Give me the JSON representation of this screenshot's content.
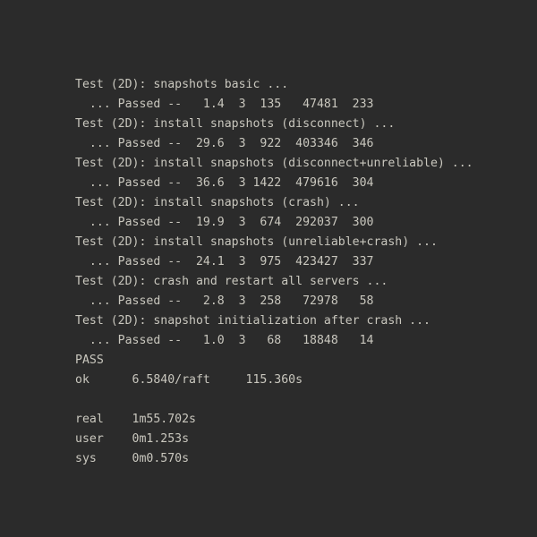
{
  "terminal": {
    "background_color": "#2b2b2b",
    "text_color": "#c9c7be",
    "font_size_px": 13.2,
    "line_height_px": 22,
    "lines": [
      "Test (2D): snapshots basic ...",
      "  ... Passed --   1.4  3  135   47481  233",
      "Test (2D): install snapshots (disconnect) ...",
      "  ... Passed --  29.6  3  922  403346  346",
      "Test (2D): install snapshots (disconnect+unreliable) ...",
      "  ... Passed --  36.6  3 1422  479616  304",
      "Test (2D): install snapshots (crash) ...",
      "  ... Passed --  19.9  3  674  292037  300",
      "Test (2D): install snapshots (unreliable+crash) ...",
      "  ... Passed --  24.1  3  975  423427  337",
      "Test (2D): crash and restart all servers ...",
      "  ... Passed --   2.8  3  258   72978   58",
      "Test (2D): snapshot initialization after crash ...",
      "  ... Passed --   1.0  3   68   18848   14",
      "PASS",
      "ok      6.5840/raft     115.360s",
      "",
      "real    1m55.702s",
      "user    0m1.253s",
      "sys     0m0.570s"
    ],
    "tests": [
      {
        "name": "Test (2D): snapshots basic ...",
        "status": "Passed",
        "time_s": "1.4",
        "peers": "3",
        "rpcs": "135",
        "bytes": "47481",
        "commits": "233"
      },
      {
        "name": "Test (2D): install snapshots (disconnect) ...",
        "status": "Passed",
        "time_s": "29.6",
        "peers": "3",
        "rpcs": "922",
        "bytes": "403346",
        "commits": "346"
      },
      {
        "name": "Test (2D): install snapshots (disconnect+unreliable) ...",
        "status": "Passed",
        "time_s": "36.6",
        "peers": "3",
        "rpcs": "1422",
        "bytes": "479616",
        "commits": "304"
      },
      {
        "name": "Test (2D): install snapshots (crash) ...",
        "status": "Passed",
        "time_s": "19.9",
        "peers": "3",
        "rpcs": "674",
        "bytes": "292037",
        "commits": "300"
      },
      {
        "name": "Test (2D): install snapshots (unreliable+crash) ...",
        "status": "Passed",
        "time_s": "24.1",
        "peers": "3",
        "rpcs": "975",
        "bytes": "423427",
        "commits": "337"
      },
      {
        "name": "Test (2D): crash and restart all servers ...",
        "status": "Passed",
        "time_s": "2.8",
        "peers": "3",
        "rpcs": "258",
        "bytes": "72978",
        "commits": "58"
      },
      {
        "name": "Test (2D): snapshot initialization after crash ...",
        "status": "Passed",
        "time_s": "1.0",
        "peers": "3",
        "rpcs": "68",
        "bytes": "18848",
        "commits": "14"
      }
    ],
    "summary": {
      "result": "PASS",
      "ok_label": "ok",
      "package": "6.5840/raft",
      "package_time": "115.360s"
    },
    "timing": {
      "real_label": "real",
      "real_value": "1m55.702s",
      "user_label": "user",
      "user_value": "0m1.253s",
      "sys_label": "sys",
      "sys_value": "0m0.570s"
    }
  }
}
